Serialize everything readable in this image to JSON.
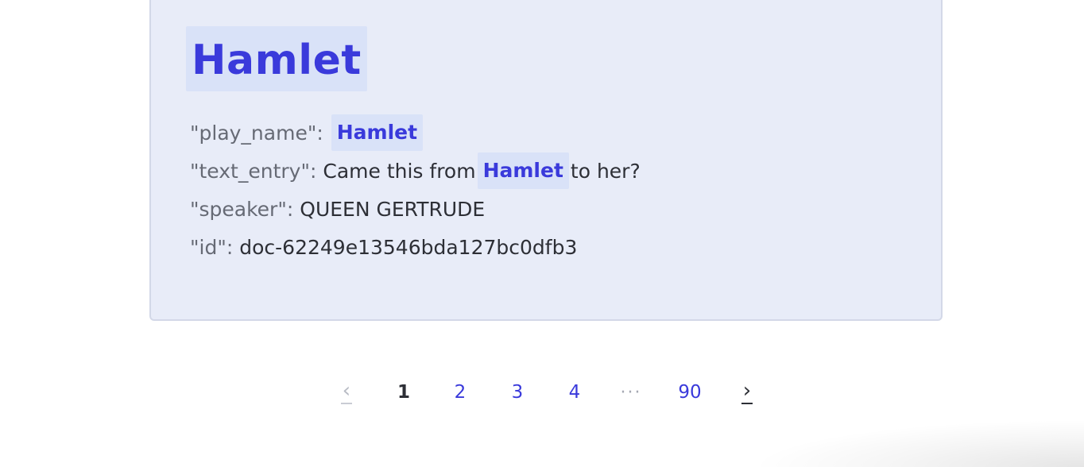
{
  "result": {
    "title": "Hamlet",
    "fields": {
      "play_name": {
        "key": "\"play_name\":",
        "value": "Hamlet"
      },
      "text_entry": {
        "key": "\"text_entry\":",
        "before": "Came this from",
        "match": "Hamlet",
        "after": "to her?"
      },
      "speaker": {
        "key": "\"speaker\":",
        "value": "QUEEN GERTRUDE"
      },
      "id": {
        "key": "\"id\":",
        "value": "doc-62249e13546bda127bc0dfb3"
      }
    }
  },
  "pagination": {
    "prev_icon": "chevron-left-icon",
    "prev_glyph": "‹",
    "next_icon": "chevron-right-icon",
    "next_glyph": "›",
    "pages": [
      "1",
      "2",
      "3",
      "4"
    ],
    "ellipsis": "···",
    "last_page": "90",
    "current_page": "1"
  },
  "colors": {
    "accent": "#3a3adb",
    "card_background": "#e8ecf8",
    "highlight": "#d9e2f8"
  }
}
